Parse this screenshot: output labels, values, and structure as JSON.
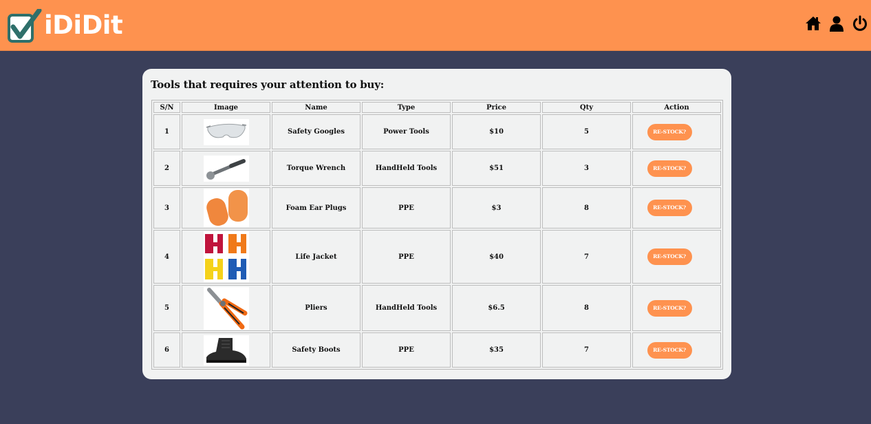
{
  "header": {
    "brand": "iDiDit",
    "brand_color": "#fe924f",
    "nav": [
      {
        "icon": "home-icon"
      },
      {
        "icon": "user-icon"
      },
      {
        "icon": "power-icon"
      }
    ]
  },
  "main": {
    "title": "Tools that requires your attention to buy:",
    "columns": [
      "S/N",
      "Image",
      "Name",
      "Type",
      "Price",
      "Qty",
      "Action"
    ],
    "rows": [
      {
        "sn": "1",
        "image": "safety-goggles-image",
        "name": "Safety Googles",
        "type": "Power Tools",
        "price": "$10",
        "qty": "5",
        "action": "RE-STOCK?"
      },
      {
        "sn": "2",
        "image": "torque-wrench-image",
        "name": "Torque Wrench",
        "type": "HandHeld Tools",
        "price": "$51",
        "qty": "3",
        "action": "RE-STOCK?"
      },
      {
        "sn": "3",
        "image": "ear-plugs-image",
        "name": "Foam Ear Plugs",
        "type": "PPE",
        "price": "$3",
        "qty": "8",
        "action": "RE-STOCK?"
      },
      {
        "sn": "4",
        "image": "life-jacket-image",
        "name": "Life Jacket",
        "type": "PPE",
        "price": "$40",
        "qty": "7",
        "action": "RE-STOCK?"
      },
      {
        "sn": "5",
        "image": "pliers-image",
        "name": "Pliers",
        "type": "HandHeld Tools",
        "price": "$6.5",
        "qty": "8",
        "action": "RE-STOCK?"
      },
      {
        "sn": "6",
        "image": "safety-boots-image",
        "name": "Safety Boots",
        "type": "PPE",
        "price": "$35",
        "qty": "7",
        "action": "RE-STOCK?"
      }
    ]
  }
}
